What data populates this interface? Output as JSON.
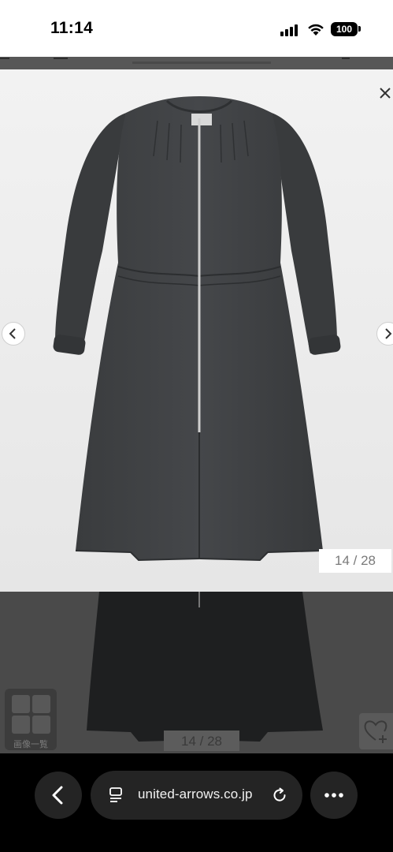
{
  "status_bar": {
    "time": "11:14",
    "battery": "100"
  },
  "viewer": {
    "image_alt": "dark grey long zip-front shirt dress with gathered waist",
    "counter": "14 / 28",
    "prev_icon": "chevron-left-icon",
    "next_icon": "chevron-right-icon",
    "close_icon": "close-icon"
  },
  "background_page": {
    "image_list_label": "画像一覧",
    "counter": "14 / 28",
    "favorite_icon": "heart-plus-icon"
  },
  "browser": {
    "url": "united-arrows.co.jp",
    "back_icon": "chevron-left-icon",
    "reader_icon": "page-menu-icon",
    "reload_icon": "reload-icon",
    "more_icon": "more-icon"
  },
  "colors": {
    "garment": "#3f4143",
    "viewer_bg": "#eeeeee",
    "dim_overlay": "#4a4a4a",
    "browser_bg": "#000000"
  }
}
